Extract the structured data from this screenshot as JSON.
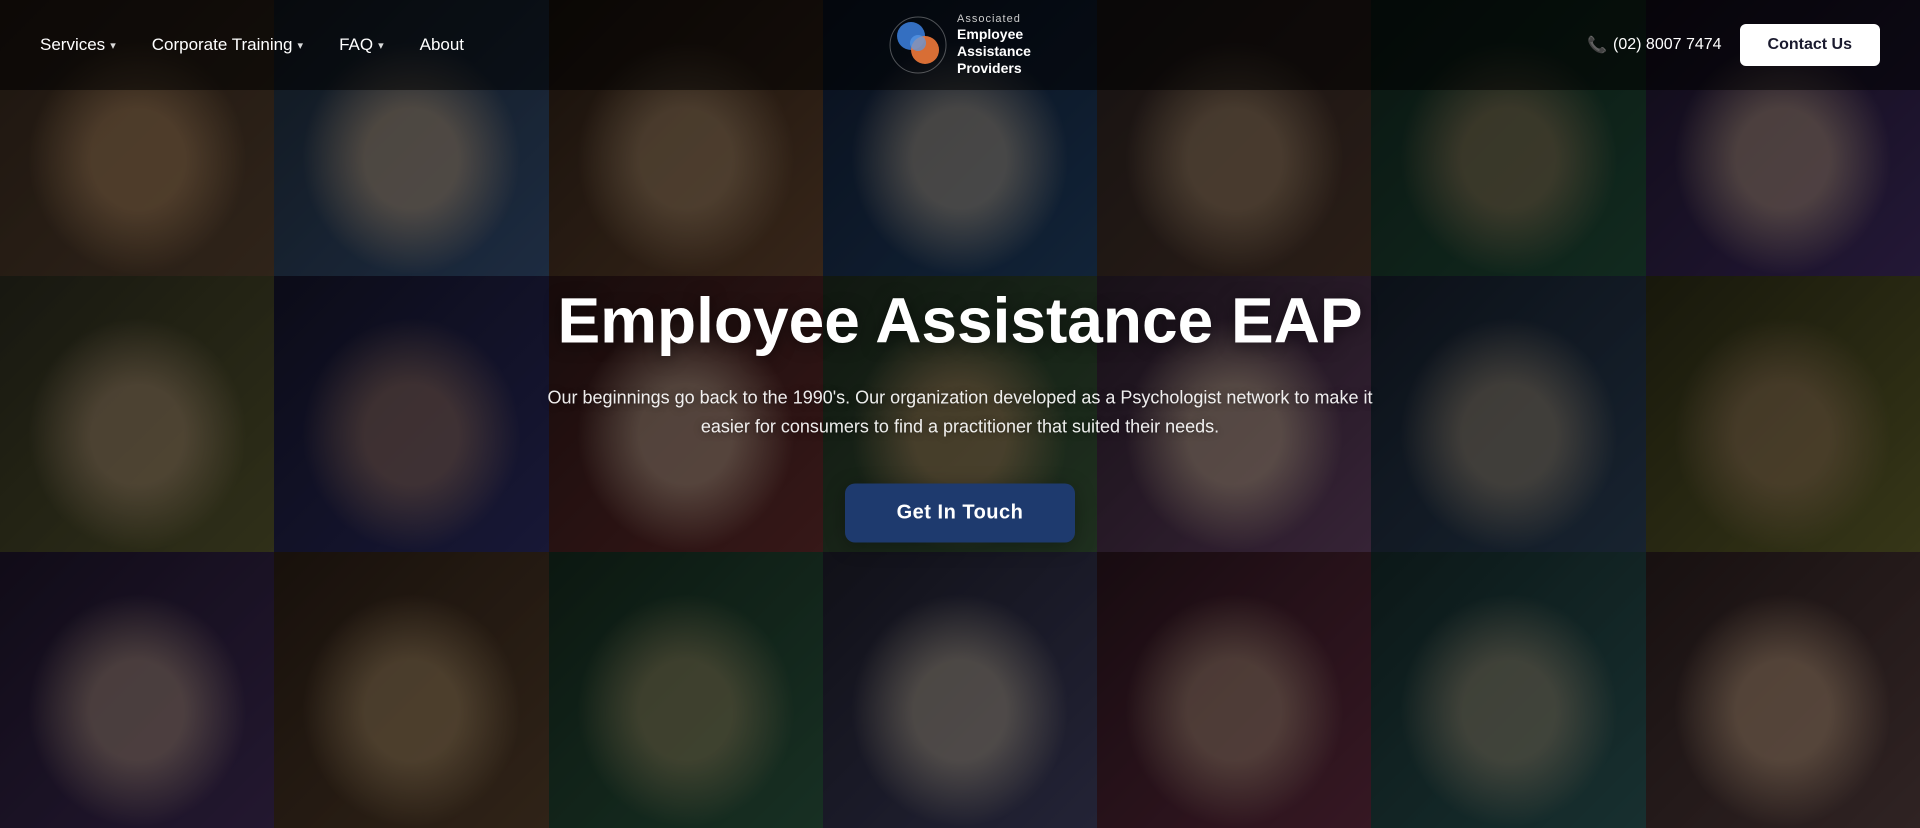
{
  "navbar": {
    "services_label": "Services",
    "corporate_training_label": "Corporate Training",
    "faq_label": "FAQ",
    "about_label": "About",
    "phone": "(02) 8007 7474",
    "contact_button": "Contact Us"
  },
  "logo": {
    "associated_text": "Associated",
    "line1": "Employee",
    "line2": "Assistance",
    "line3": "Providers"
  },
  "hero": {
    "title": "Employee Assistance EAP",
    "subtitle": "Our beginnings go back to the 1990's. Our organization developed as a Psychologist network to make it easier for consumers to find a practitioner that suited their needs.",
    "cta_label": "Get In Touch"
  },
  "grid": {
    "cells": [
      "c1",
      "c2",
      "c3",
      "c4",
      "c5",
      "c6",
      "c7",
      "c8",
      "c9",
      "c10",
      "c11",
      "c12",
      "c13",
      "c14",
      "c15",
      "c16",
      "c17",
      "c18",
      "c19",
      "c20",
      "c21"
    ]
  }
}
